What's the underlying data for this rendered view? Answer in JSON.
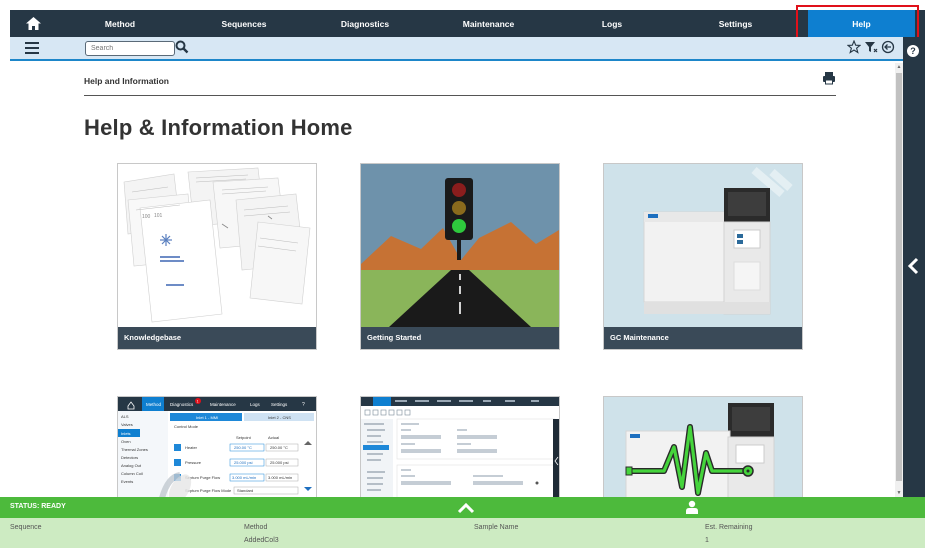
{
  "nav": {
    "tabs": [
      "Method",
      "Sequences",
      "Diagnostics",
      "Maintenance",
      "Logs",
      "Settings",
      "Help"
    ],
    "active": "Help"
  },
  "search": {
    "placeholder": "Search"
  },
  "page": {
    "section_title": "Help and Information",
    "title": "Help & Information Home"
  },
  "cards": [
    {
      "caption": "Knowledgebase",
      "icon": "document-stack"
    },
    {
      "caption": "Getting Started",
      "icon": "traffic-light-road"
    },
    {
      "caption": "GC Maintenance",
      "icon": "gc-instrument"
    },
    {
      "caption": "",
      "icon": "instrument-screen-method"
    },
    {
      "caption": "",
      "icon": "method-editor-screen"
    },
    {
      "caption": "",
      "icon": "gc-instrument-signal"
    }
  ],
  "screen_thumb": {
    "tabs": [
      "Method",
      "Diagnostics",
      "Maintenance",
      "Logs",
      "Settings",
      "?"
    ],
    "badge": "1",
    "sidebar": [
      "ALS",
      "Valves",
      "Inlets",
      "Oven",
      "Thermal Zones",
      "Detectors",
      "Analog Out",
      "Column Coil",
      "Events"
    ],
    "inlets": [
      "Inlet 1 - MMI",
      "Inlet 2 - CNS"
    ],
    "control_mode": "Control Mode",
    "col_setpoint": "Setpoint",
    "col_actual": "Actual",
    "rows": [
      {
        "label": "Heater",
        "setpoint": "250.00 °C",
        "actual": "250.00 °C"
      },
      {
        "label": "Pressure",
        "setpoint": "25.000 psi",
        "actual": "25.000 psi"
      },
      {
        "label": "Septum Purge Flow",
        "setpoint": "3.000 mL/min",
        "actual": "3.000 mL/min"
      }
    ],
    "purge_mode_label": "Septum Purge Flow Mode",
    "purge_mode_value": "Standard"
  },
  "status": {
    "state": "STATUS: READY",
    "headers": {
      "sequence": "Sequence",
      "method": "Method",
      "sample": "Sample Name",
      "remaining": "Est. Remaining"
    },
    "values": {
      "method": "AddedCol3",
      "remaining": "1"
    }
  },
  "colors": {
    "nav_bg": "#263745",
    "active_tab": "#0e7fd0",
    "highlight": "#e0101a",
    "status_green": "#4dba3c",
    "status_light": "#cdebc2"
  }
}
